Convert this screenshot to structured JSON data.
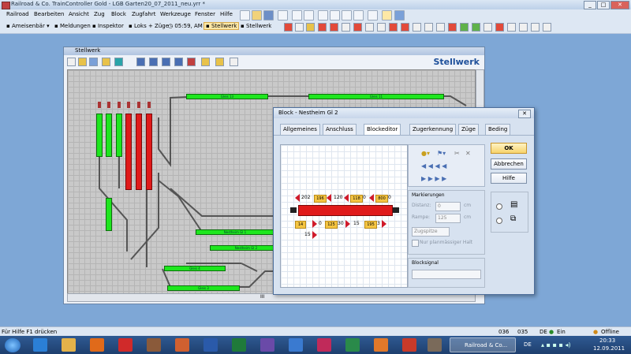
{
  "window": {
    "title": "Railroad & Co. TrainController Gold - LGB Garten20_07_2011_neu.yrr *"
  },
  "menu": [
    "Railroad",
    "Bearbeiten",
    "Ansicht",
    "Zug",
    "Block",
    "Zugfahrt",
    "Werkzeuge",
    "Fenster",
    "Hilfe"
  ],
  "toolbar": {
    "user": "Ameisenbär",
    "messages": "Meldungen",
    "inspector": "Inspektor",
    "locos": "Loks + Züge",
    "clock": "05:59, AM",
    "stellwerk_active": "Stellwerk",
    "stellwerk2": "Stellwerk"
  },
  "stellwerk": {
    "caption": "Stellwerk",
    "heading": "Stellwerk",
    "blocks": {
      "g13": "Gleis 13",
      "g11": "Gleis 11",
      "n1": "Nestheim Gl 1",
      "n2": "Nestheim Gl 2",
      "g4": "Gleis 4",
      "g3": "Gleis 3"
    },
    "scroll_marker": "III"
  },
  "dialog": {
    "title": "Block - Nestheim Gl 2",
    "tabs": [
      "Allgemeines",
      "Anschluss",
      "Blockeditor",
      "Zugerkennung",
      "Züge",
      "Beding"
    ],
    "ok": "OK",
    "cancel": "Abbrechen",
    "help": "Hilfe",
    "markierungen": "Markierungen",
    "distanz_label": "Distanz:",
    "distanz_value": "0",
    "rampe_label": "Rampe:",
    "rampe_value": "125",
    "unit": "cm",
    "zugspitze": "Zugspitze",
    "nur_halt": "Nur planmässiger Halt",
    "blocksignal": "Blocksignal",
    "editor_top": [
      "202",
      "196",
      "120",
      "118",
      "0",
      "800",
      "0"
    ],
    "editor_bottom": [
      "14",
      "0",
      "125",
      "30",
      "15",
      "195",
      "3"
    ],
    "editor_bottom2": "15"
  },
  "statusbar": {
    "help": "Für Hilfe F1 drücken",
    "n1": "036",
    "n2": "035",
    "lang": "DE",
    "ein": "Ein",
    "offline": "Offline"
  },
  "taskbar": {
    "active_task": "Railroad & Co...",
    "lang": "DE",
    "time": "20:33",
    "date": "12.09.2011"
  }
}
